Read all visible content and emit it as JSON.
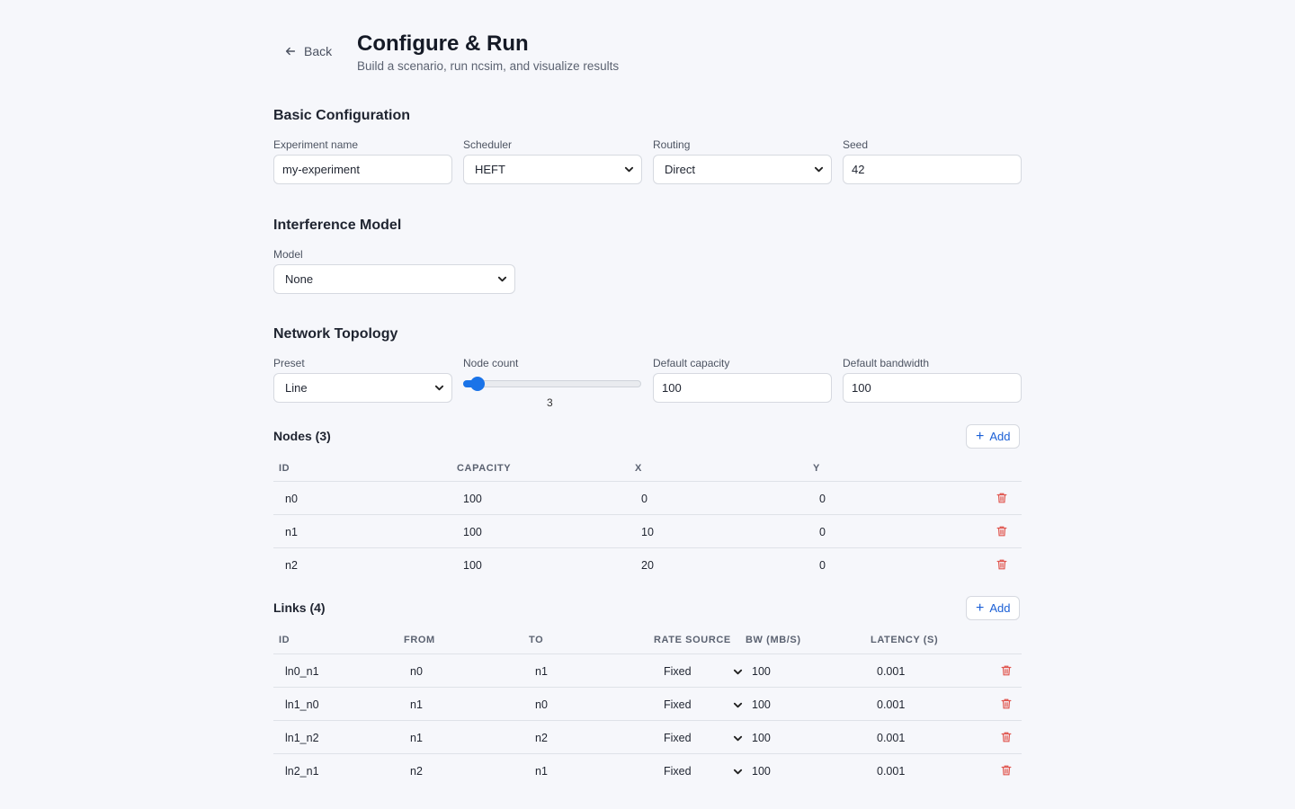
{
  "header": {
    "back_label": "Back",
    "title": "Configure & Run",
    "subtitle": "Build a scenario, run ncsim, and visualize results"
  },
  "basic": {
    "title": "Basic Configuration",
    "experiment_label": "Experiment name",
    "experiment_value": "my-experiment",
    "scheduler_label": "Scheduler",
    "scheduler_value": "HEFT",
    "routing_label": "Routing",
    "routing_value": "Direct",
    "seed_label": "Seed",
    "seed_value": "42"
  },
  "interference": {
    "title": "Interference Model",
    "model_label": "Model",
    "model_value": "None"
  },
  "topology": {
    "title": "Network Topology",
    "preset_label": "Preset",
    "preset_value": "Line",
    "node_count_label": "Node count",
    "node_count_value": "3",
    "node_count_fraction": 0.08,
    "capacity_label": "Default capacity",
    "capacity_value": "100",
    "bandwidth_label": "Default bandwidth",
    "bandwidth_value": "100"
  },
  "nodes": {
    "title": "Nodes (3)",
    "add_label": "Add",
    "headers": [
      "ID",
      "CAPACITY",
      "X",
      "Y"
    ],
    "rows": [
      {
        "id": "n0",
        "capacity": "100",
        "x": "0",
        "y": "0"
      },
      {
        "id": "n1",
        "capacity": "100",
        "x": "10",
        "y": "0"
      },
      {
        "id": "n2",
        "capacity": "100",
        "x": "20",
        "y": "0"
      }
    ]
  },
  "links": {
    "title": "Links (4)",
    "add_label": "Add",
    "headers": [
      "ID",
      "FROM",
      "TO",
      "RATE SOURCE",
      "BW (MB/S)",
      "LATENCY (S)"
    ],
    "rows": [
      {
        "id": "ln0_n1",
        "from": "n0",
        "to": "n1",
        "rate": "Fixed",
        "bw": "100",
        "latency": "0.001"
      },
      {
        "id": "ln1_n0",
        "from": "n1",
        "to": "n0",
        "rate": "Fixed",
        "bw": "100",
        "latency": "0.001"
      },
      {
        "id": "ln1_n2",
        "from": "n1",
        "to": "n2",
        "rate": "Fixed",
        "bw": "100",
        "latency": "0.001"
      },
      {
        "id": "ln2_n1",
        "from": "n2",
        "to": "n1",
        "rate": "Fixed",
        "bw": "100",
        "latency": "0.001"
      }
    ]
  },
  "colors": {
    "accent": "#1a73e8",
    "danger": "#e0564f",
    "background": "#f6f7fb"
  }
}
